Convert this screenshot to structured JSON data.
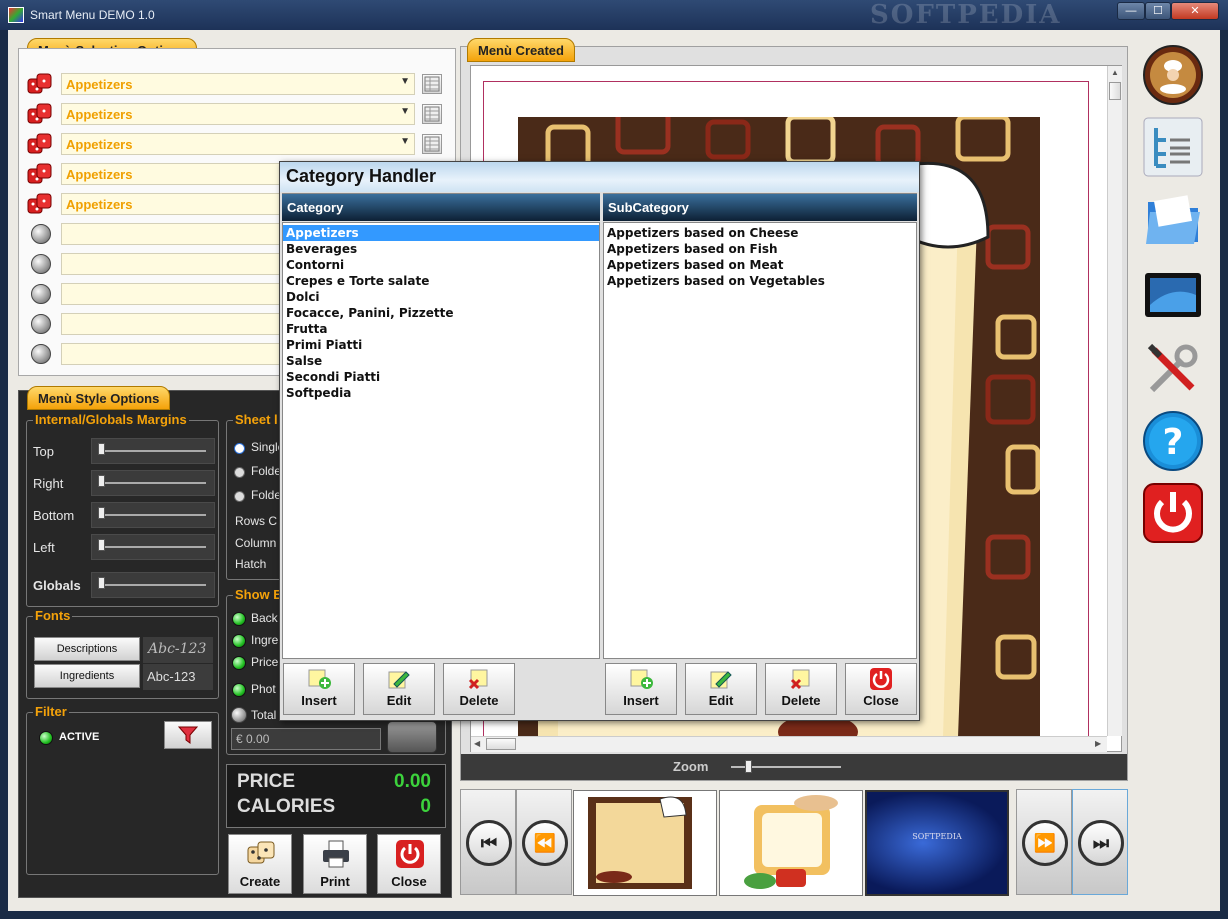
{
  "window": {
    "title": "Smart Menu DEMO 1.0",
    "watermark": "SOFTPEDIA",
    "min": "—",
    "max": "☐",
    "close": "✕"
  },
  "selection": {
    "tab": "Menù Selection Options",
    "rows": [
      {
        "value": "Appetizers",
        "has_arrow": true
      },
      {
        "value": "Appetizers",
        "has_arrow": true
      },
      {
        "value": "Appetizers",
        "has_arrow": true
      },
      {
        "value": "Appetizers",
        "has_arrow": false
      },
      {
        "value": "Appetizers",
        "has_arrow": false
      },
      {
        "value": ""
      },
      {
        "value": ""
      },
      {
        "value": ""
      },
      {
        "value": ""
      },
      {
        "value": ""
      }
    ]
  },
  "style": {
    "tab": "Menù Style Options",
    "margins": {
      "title": "Internal/Globals Margins",
      "items": [
        "Top",
        "Right",
        "Bottom",
        "Left",
        "Globals"
      ]
    },
    "sheet": {
      "title": "Sheet l",
      "options": [
        "Single",
        "Folde",
        "Folde"
      ],
      "labels": [
        "Rows C",
        "Column",
        "Hatch"
      ]
    },
    "fonts": {
      "title": "Fonts",
      "descriptions_btn": "Descriptions",
      "ingredients_btn": "Ingredients",
      "sample1": "Abc-123",
      "sample2": "Abc-123"
    },
    "filter": {
      "title": "Filter",
      "status": "ACTIVE"
    },
    "show": {
      "title": "Show E",
      "items": [
        "Back",
        "Ingre",
        "Price",
        "Phot",
        "Total"
      ]
    },
    "total_field": "€ 0.00",
    "price_label": "PRICE",
    "price_value": "0.00",
    "calories_label": "CALORIES",
    "calories_value": "0",
    "buttons": {
      "create": "Create",
      "print": "Print",
      "close": "Close"
    }
  },
  "menu": {
    "tab": "Menù Created",
    "zoom_label": "Zoom"
  },
  "dialog": {
    "title": "Category Handler",
    "category_header": "Category",
    "subcategory_header": "SubCategory",
    "categories": [
      "Appetizers",
      "Beverages",
      "Contorni",
      "Crepes e Torte salate",
      "Dolci",
      "Focacce, Panini, Pizzette",
      "Frutta",
      "Primi Piatti",
      "Salse",
      "Secondi Piatti",
      "Softpedia"
    ],
    "selected_category": "Appetizers",
    "subcategories": [
      "Appetizers based on Cheese",
      "Appetizers based on Fish",
      "Appetizers based on Meat",
      "Appetizers based on Vegetables"
    ],
    "buttons": {
      "insert": "Insert",
      "edit": "Edit",
      "delete": "Delete",
      "close": "Close"
    }
  },
  "thumbnails": {
    "third_text": "SOFTPEDIA"
  },
  "sidebar": [
    "restaurant-icon",
    "tree-structure-icon",
    "folders-icon",
    "monitor-icon",
    "tools-icon",
    "help-icon",
    "power-icon"
  ],
  "colors": {
    "accent": "#f4a20a",
    "selection": "#3399ff",
    "led": "#22c022"
  }
}
